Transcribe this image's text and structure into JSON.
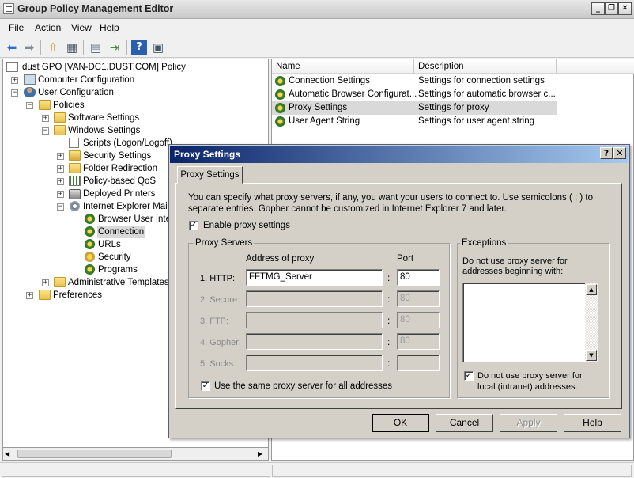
{
  "window": {
    "title": "Group Policy Management Editor",
    "min": "_",
    "restore": "❐",
    "close": "✕"
  },
  "menu": [
    "File",
    "Action",
    "View",
    "Help"
  ],
  "tree": {
    "root": "dust GPO [VAN-DC1.DUST.COM] Policy",
    "computer_configuration": "Computer Configuration",
    "user_configuration": "User Configuration",
    "policies": "Policies",
    "software_settings": "Software Settings",
    "windows_settings": "Windows Settings",
    "scripts": "Scripts (Logon/Logoff)",
    "security_settings": "Security Settings",
    "folder_redirection": "Folder Redirection",
    "policy_qos": "Policy-based QoS",
    "deployed_printers": "Deployed Printers",
    "ie_maintenance": "Internet Explorer Maint",
    "browser_ui": "Browser User Inter",
    "connection": "Connection",
    "urls": "URLs",
    "security": "Security",
    "programs": "Programs",
    "admin_templates": "Administrative Templates: I",
    "preferences": "Preferences"
  },
  "list": {
    "columns": [
      "Name",
      "Description"
    ],
    "rows": [
      {
        "name": "Connection Settings",
        "description": "Settings for connection settings"
      },
      {
        "name": "Automatic Browser Configurat...",
        "description": "Settings for automatic browser c..."
      },
      {
        "name": "Proxy Settings",
        "description": "Settings for proxy"
      },
      {
        "name": "User Agent String",
        "description": "Settings for user agent string"
      }
    ]
  },
  "dialog": {
    "title": "Proxy Settings",
    "help": "?",
    "close": "✕",
    "tab": "Proxy Settings",
    "intro_line1": "You can specify what proxy servers, if any, you want your users to connect to. Use semicolons ( ; ) to",
    "intro_line2": "separate entries. Gopher cannot be customized in Internet Explorer 7 and later.",
    "enable_label": "Enable proxy settings",
    "enable_checked": "✓",
    "proxy_servers_group": "Proxy Servers",
    "address_header": "Address of proxy",
    "port_header": "Port",
    "proxies": [
      {
        "label": "1. HTTP:",
        "address": "FFTMG_Server",
        "port": "80"
      },
      {
        "label": "2. Secure:",
        "address": "",
        "port": "80"
      },
      {
        "label": "3. FTP:",
        "address": "",
        "port": "80"
      },
      {
        "label": "4. Gopher:",
        "address": "",
        "port": "80"
      },
      {
        "label": "5. Socks:",
        "address": "",
        "port": ""
      }
    ],
    "colon": ":",
    "same_proxy_label": "Use the same proxy server for all addresses",
    "same_proxy_checked": "✓",
    "exceptions_group": "Exceptions",
    "exceptions_line1": "Do not use proxy server for",
    "exceptions_line2": "addresses beginning with:",
    "local_label_line1": "Do not use proxy server for",
    "local_label_line2": "local (intranet) addresses.",
    "local_checked": "✓",
    "buttons": {
      "ok": "OK",
      "cancel": "Cancel",
      "apply": "Apply",
      "help": "Help"
    }
  }
}
